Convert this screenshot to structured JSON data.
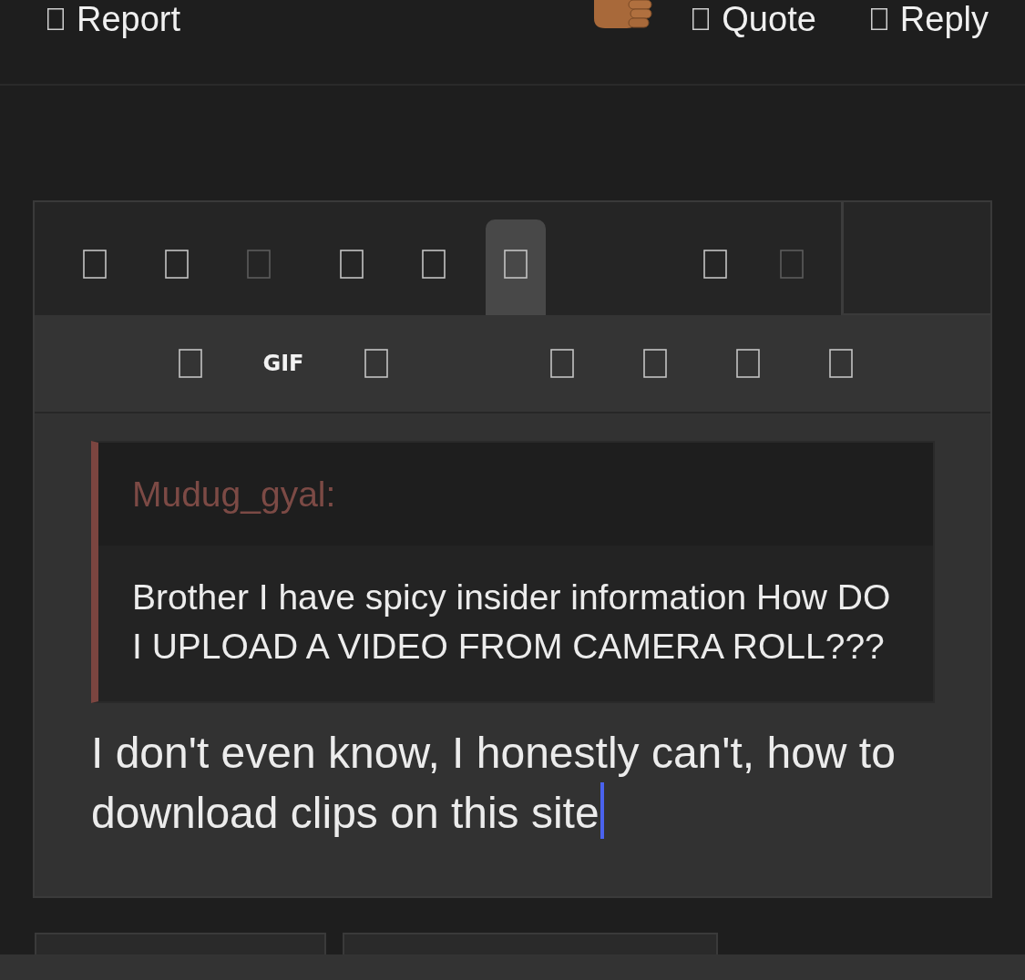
{
  "post_actions": {
    "left": [
      {
        "label": "Report"
      }
    ],
    "right": [
      {
        "label": "Quote"
      },
      {
        "label": "Reply"
      }
    ]
  },
  "editor": {
    "toolbar": {
      "row_1": [
        [
          {
            "kind": "icon",
            "selected": false,
            "disabled": false
          },
          {
            "kind": "icon",
            "selected": false,
            "disabled": false
          },
          {
            "kind": "icon",
            "selected": false,
            "disabled": true
          }
        ],
        [
          {
            "kind": "icon",
            "selected": false,
            "disabled": false
          },
          {
            "kind": "icon",
            "selected": false,
            "disabled": false
          },
          {
            "kind": "icon",
            "selected": true,
            "disabled": false
          }
        ],
        [
          {
            "kind": "icon",
            "selected": false,
            "disabled": false
          },
          {
            "kind": "icon",
            "selected": false,
            "disabled": true
          }
        ]
      ],
      "row_2": [
        [
          {
            "kind": "icon"
          },
          {
            "kind": "text",
            "label": "GIF"
          },
          {
            "kind": "icon"
          }
        ],
        [
          {
            "kind": "icon"
          },
          {
            "kind": "icon"
          },
          {
            "kind": "icon"
          },
          {
            "kind": "icon"
          }
        ]
      ]
    },
    "quote": {
      "author": "Mudug_gyal:",
      "text": "Brother I have spicy insider information How DO I UPLOAD A VIDEO FROM CAMERA ROLL???"
    },
    "message": {
      "value": "I don't even know, I honestly can't, how to download clips on this site",
      "focused": true
    }
  }
}
